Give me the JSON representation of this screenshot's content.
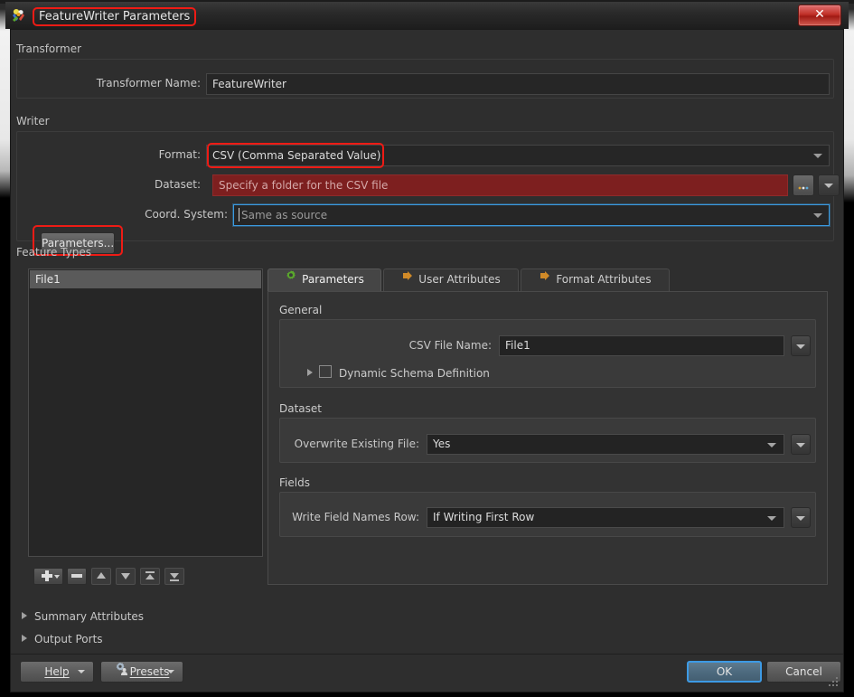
{
  "window": {
    "title": "FeatureWriter Parameters",
    "app_icon": "fme-app-icon",
    "close_label": "✕"
  },
  "transformer": {
    "group_label": "Transformer",
    "name_label": "Transformer Name:",
    "name_value": "FeatureWriter"
  },
  "writer": {
    "group_label": "Writer",
    "format_label": "Format:",
    "format_value": "CSV (Comma Separated Value)",
    "dataset_label": "Dataset:",
    "dataset_placeholder": "Specify a folder for the CSV file",
    "browse_label": "...",
    "parameters_button": "Parameters...",
    "coord_label": "Coord. System:",
    "coord_placeholder": "Same as source"
  },
  "feature_types": {
    "group_label": "Feature Types",
    "list_items": [
      "File1"
    ],
    "toolbar": [
      {
        "name": "add-feature-type-button",
        "glyph": "+"
      },
      {
        "name": "remove-feature-type-button",
        "glyph": "–"
      },
      {
        "name": "move-up-button",
        "glyph": "▲"
      },
      {
        "name": "move-down-button",
        "glyph": "▼"
      },
      {
        "name": "move-to-top-button",
        "glyph": "⤒"
      },
      {
        "name": "move-to-bottom-button",
        "glyph": "⤓"
      }
    ]
  },
  "tabs": [
    {
      "label": "Parameters",
      "icon": "green-gear-icon",
      "active": true
    },
    {
      "label": "User Attributes",
      "icon": "orange-arrow-icon",
      "active": false
    },
    {
      "label": "Format Attributes",
      "icon": "orange-arrow-icon",
      "active": false
    }
  ],
  "parameters_tab": {
    "general": {
      "section_label": "General",
      "csv_file_name_label": "CSV File Name:",
      "csv_file_name_value": "File1",
      "dynamic_schema_label": "Dynamic Schema Definition",
      "dynamic_schema_checked": false
    },
    "dataset": {
      "section_label": "Dataset",
      "overwrite_label": "Overwrite Existing File:",
      "overwrite_value": "Yes"
    },
    "fields": {
      "section_label": "Fields",
      "write_field_names_label": "Write Field Names Row:",
      "write_field_names_value": "If Writing First Row"
    }
  },
  "collapsible": {
    "summary_attributes": "Summary Attributes",
    "output_ports": "Output Ports"
  },
  "footer": {
    "help_label": "Help",
    "presets_label": "Presets",
    "ok_label": "OK",
    "cancel_label": "Cancel"
  },
  "colors": {
    "highlight_red": "#ee1b15",
    "error_field": "#7d1f1f",
    "focus_blue": "#3a9ae0",
    "tab_green": "#5aa82c",
    "tab_orange": "#d08a28"
  }
}
